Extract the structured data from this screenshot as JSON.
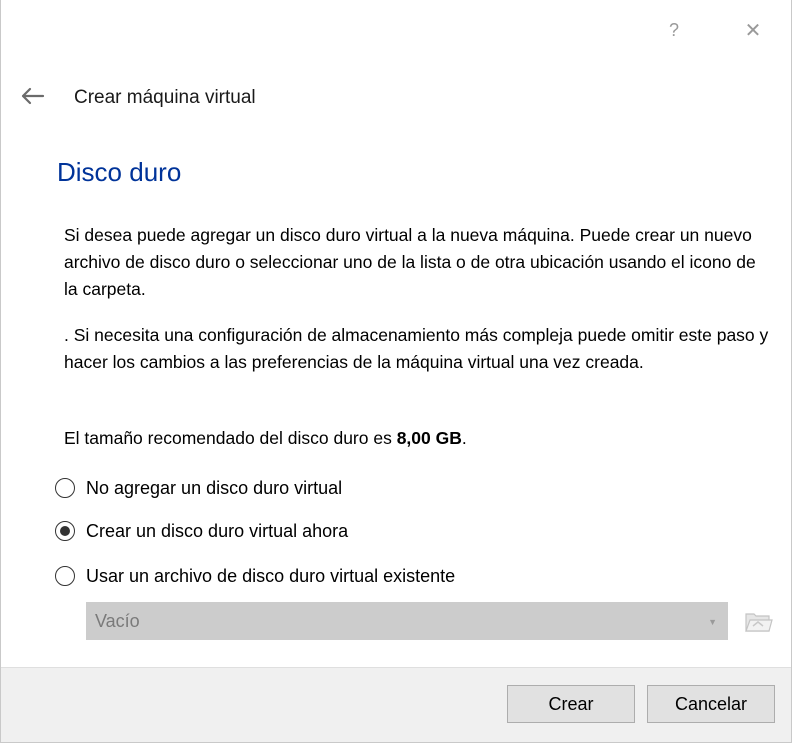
{
  "titlebar": {
    "help_glyph": "?",
    "close_glyph": "✕"
  },
  "header": {
    "title": "Crear máquina virtual"
  },
  "page": {
    "title": "Disco duro",
    "paragraph1": "Si desea puede agregar un disco duro virtual a la nueva máquina. Puede crear un nuevo archivo de disco duro o seleccionar uno de la lista o de otra ubicación usando el icono de la carpeta.",
    "paragraph2": ". Si necesita una configuración de almacenamiento más compleja puede omitir este paso y hacer los cambios a las preferencias de la máquina virtual una vez creada.",
    "recommended_prefix": "El tamaño recomendado del disco duro es ",
    "recommended_size": "8,00 GB",
    "recommended_suffix": "."
  },
  "options": [
    {
      "label": "No agregar un disco duro virtual",
      "selected": false
    },
    {
      "label": "Crear un disco duro virtual ahora",
      "selected": true
    },
    {
      "label": "Usar un archivo de disco duro virtual existente",
      "selected": false
    }
  ],
  "disk_selector": {
    "value": "Vacío",
    "enabled": false
  },
  "footer": {
    "create_label": "Crear",
    "cancel_label": "Cancelar"
  },
  "colors": {
    "page_title": "#003399",
    "footer_bg": "#f0f0f0",
    "button_bg": "#e1e1e1",
    "combo_disabled_bg": "#cccccc"
  },
  "icons": {
    "back": "arrow-left-icon",
    "folder": "folder-open-icon",
    "help": "help-icon",
    "close": "close-icon",
    "combo_arrow": "chevron-down-icon"
  }
}
